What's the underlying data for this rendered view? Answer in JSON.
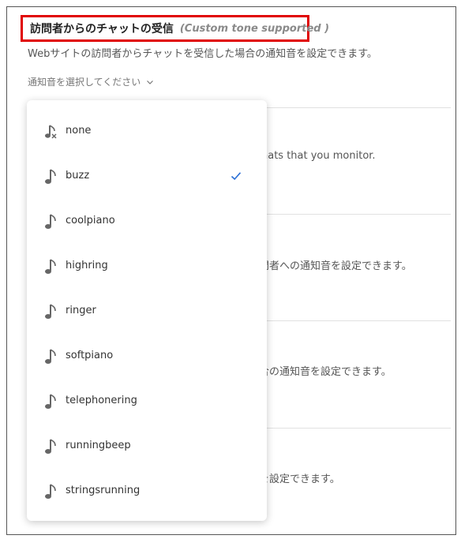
{
  "header": {
    "title": "訪問者からのチャットの受信",
    "note": "(Custom tone supported )",
    "description": "Webサイトの訪問者からチャットを受信した場合の通知音を設定できます。"
  },
  "select": {
    "placeholder": "通知音を選択してください"
  },
  "background_rows": [
    {
      "text": "hats that you monitor."
    },
    {
      "text": "問者への通知音を設定できます。"
    },
    {
      "text": "合の通知音を設定できます。"
    },
    {
      "text": "を設定できます。"
    }
  ],
  "dropdown": {
    "selected": "buzz",
    "check_color": "#2b6fd6",
    "options": [
      {
        "label": "none",
        "icon": "muted-note-icon"
      },
      {
        "label": "buzz",
        "icon": "music-note-icon"
      },
      {
        "label": "coolpiano",
        "icon": "music-note-icon"
      },
      {
        "label": "highring",
        "icon": "music-note-icon"
      },
      {
        "label": "ringer",
        "icon": "music-note-icon"
      },
      {
        "label": "softpiano",
        "icon": "music-note-icon"
      },
      {
        "label": "telephonering",
        "icon": "music-note-icon"
      },
      {
        "label": "runningbeep",
        "icon": "music-note-icon"
      },
      {
        "label": "stringsrunning",
        "icon": "music-note-icon"
      }
    ]
  }
}
